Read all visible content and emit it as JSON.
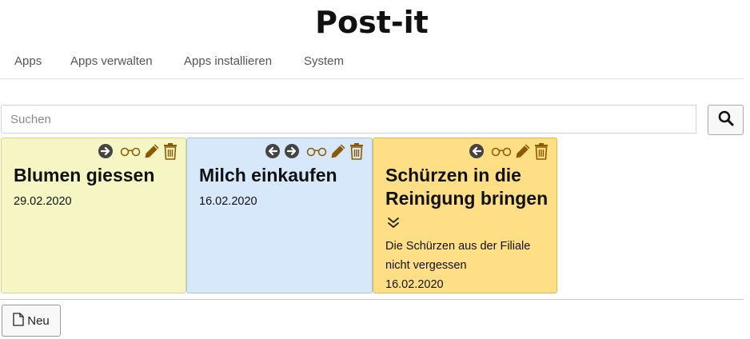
{
  "page": {
    "title": "Post-it"
  },
  "nav": {
    "items": [
      "Apps",
      "Apps verwalten",
      "Apps installieren",
      "System"
    ]
  },
  "search": {
    "placeholder": "Suchen",
    "value": "",
    "button_icon": "search-icon"
  },
  "notes": [
    {
      "title": "Blumen giessen",
      "date": "29.02.2020",
      "text": "",
      "color": "#f5f6c4",
      "icons": [
        "arrow-right-icon",
        "glasses-icon",
        "pencil-icon",
        "trash-icon"
      ]
    },
    {
      "title": "Milch einkaufen",
      "date": "16.02.2020",
      "text": "",
      "color": "#d7e8fb",
      "icons": [
        "arrow-left-icon",
        "arrow-right-icon",
        "glasses-icon",
        "pencil-icon",
        "trash-icon"
      ]
    },
    {
      "title": "Schürzen in die Reinigung bringen",
      "date": "16.02.2020",
      "text": "Die Schürzen aus der Filiale nicht vergessen",
      "color": "#fedf85",
      "icons": [
        "arrow-left-icon",
        "glasses-icon",
        "pencil-icon",
        "trash-icon",
        "double-chevron-down-icon"
      ]
    }
  ],
  "footer": {
    "new_label": "Neu",
    "new_icon": "file-icon"
  },
  "colors": {
    "icon_dark": "#444444",
    "icon_brown": "#8b5a00"
  }
}
